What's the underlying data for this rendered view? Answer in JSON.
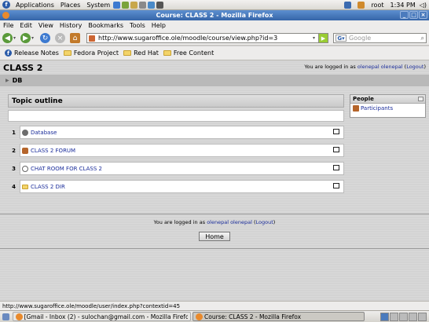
{
  "panel": {
    "menus": [
      "Applications",
      "Places",
      "System"
    ],
    "user": "root",
    "time": "1:34 PM"
  },
  "window": {
    "title": "Course: CLASS 2 - Mozilla Firefox"
  },
  "menubar": [
    "File",
    "Edit",
    "View",
    "History",
    "Bookmarks",
    "Tools",
    "Help"
  ],
  "nav": {
    "url": "http://www.sugaroffice.ole/moodle/course/view.php?id=3",
    "search_placeholder": "Google"
  },
  "bookmarks": [
    "Release Notes",
    "Fedora Project",
    "Red Hat",
    "Free Content"
  ],
  "page": {
    "course_title": "CLASS 2",
    "login_prefix": "You are logged in as ",
    "login_user": "olenepal olenepal",
    "logout": "Logout",
    "breadcrumb": "DB",
    "topic_outline": "Topic outline",
    "sections": [
      {
        "num": "1",
        "label": "Database",
        "icon": "database-icon",
        "color": "#6d6d6d"
      },
      {
        "num": "2",
        "label": "CLASS 2 FORUM",
        "icon": "forum-icon",
        "color": "#b5652b"
      },
      {
        "num": "3",
        "label": "CHAT ROOM FOR CLASS 2",
        "icon": "chat-icon",
        "color": "#d8d8d8"
      },
      {
        "num": "4",
        "label": "CLASS 2 DIR",
        "icon": "folder-icon",
        "color": "#f3d46a"
      }
    ],
    "people": {
      "title": "People",
      "participants": "Participants"
    },
    "footer_login_prefix": "You are logged in as ",
    "footer_login_user": "olenepal olenepal",
    "footer_logout": "Logout",
    "home_button": "Home"
  },
  "status": "http://www.sugaroffice.ole/moodle/user/index.php?contextid=45",
  "taskbar": [
    {
      "label": "[Gmail - Inbox (2) - sulochan@gmail.com - Mozilla Firefox]",
      "active": false
    },
    {
      "label": "Course: CLASS 2 - Mozilla Firefox",
      "active": true
    }
  ]
}
